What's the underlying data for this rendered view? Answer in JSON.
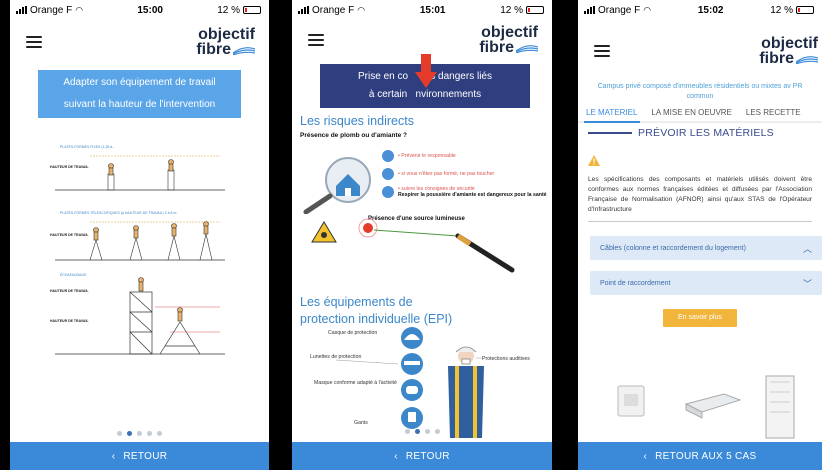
{
  "screens": [
    {
      "status": {
        "carrier": "Orange F",
        "time": "15:00",
        "battery": "12 %"
      },
      "logo": {
        "line1": "objectif",
        "line2": "fibre"
      },
      "banner": {
        "line1": "Adapter son équipement de travail",
        "line2": "suivant la hauteur de l'intervention"
      },
      "figure": {
        "label_top": "PLATES-FORMES FIXES (1,25 à...",
        "label_mid": "PLATES-FORMES TÉLESCOPIQUES (à HAUTEUR DE TRAVAIL) 2 à 8 m",
        "label_low": "ÉCHAFAUDAGE",
        "height_label": "HAUTEUR DE TRAVAIL"
      },
      "carousel": {
        "count": 5,
        "active": 1
      },
      "footer": {
        "label": "RETOUR"
      }
    },
    {
      "status": {
        "carrier": "Orange F",
        "time": "15:01",
        "battery": "12 %"
      },
      "logo": {
        "line1": "objectif",
        "line2": "fibre"
      },
      "banner": {
        "line1": "Prise en co    des dangers liés",
        "line2": "à certain   nvironnements"
      },
      "section1": {
        "title": "Les risques indirects",
        "subtitle": "Présence de plomb ou d'amiante ?",
        "items": [
          "• Prévenir le responsable",
          "• si vous n'êtes pas formé, ne pas toucher",
          "• suivre les consignes de sécurité",
          "Respirer la poussière d'amiante est dangereux pour la santé"
        ],
        "light_label": "Présence d'une source lumineuse"
      },
      "section2": {
        "title_line1": "Les équipements de",
        "title_line2": "protection individuelle (EPI)",
        "labels": [
          "Casque de protection",
          "Lunettes de protection",
          "Masque conforme adapté à l'activité",
          "Gants",
          "Protections auditives"
        ]
      },
      "carousel": {
        "count": 4,
        "active": 1
      },
      "footer": {
        "label": "RETOUR"
      }
    },
    {
      "status": {
        "carrier": "Orange F",
        "time": "15:02",
        "battery": "12 %"
      },
      "logo": {
        "line1": "objectif",
        "line2": "fibre"
      },
      "breadcrumb": "Campus privé composé d'immeubles résidentiels ou mixtes av PR commun",
      "tabs": [
        "LE MATERIEL",
        "LA MISE EN OEUVRE",
        "LES RECETTE"
      ],
      "section_title": "PRÉVOIR LES MATÉRIELS",
      "warning_text": "Les spécifications des composants et matériels utilisés doivent être conformes aux normes françaises éditées et diffusées par l'Association Française de Normalisation (AFNOR) ainsi qu'aux STAS de l'Opérateur d'Infrastructure",
      "accordions": [
        {
          "label": "Câbles (colonne et raccordement du logement)",
          "state": "open"
        },
        {
          "label": "Point de raccordement",
          "state": "closed"
        }
      ],
      "cta": "En savoir plus",
      "footer": {
        "label": "RETOUR AUX 5 CAS"
      }
    }
  ],
  "colors": {
    "footer": "#3b8ad9",
    "banner_light": "#5aa5e8",
    "banner_dark": "#2f3e7e",
    "cta": "#f0b53a",
    "accent": "#3b87c9"
  }
}
